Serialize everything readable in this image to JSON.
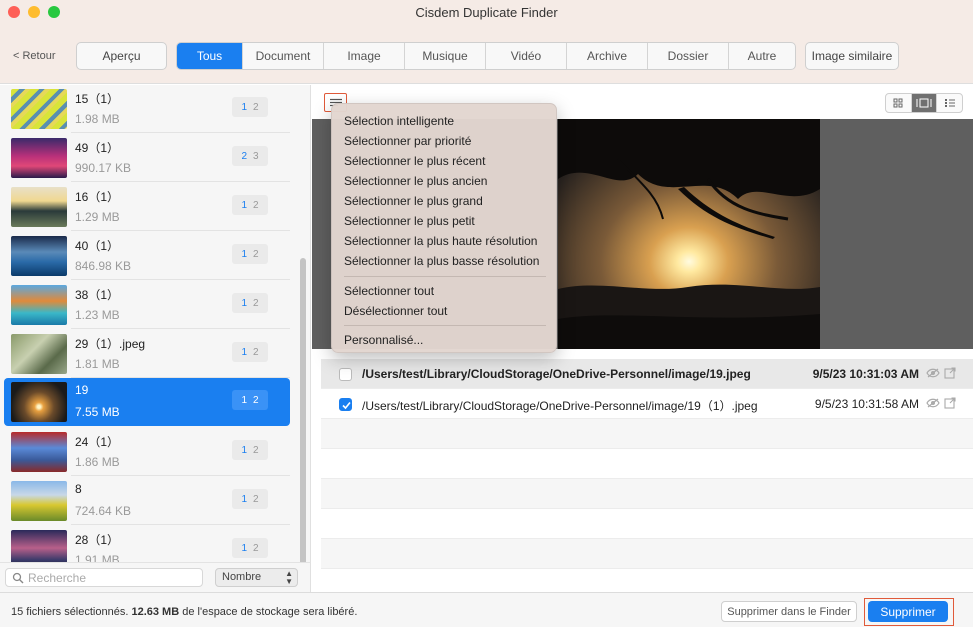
{
  "window": {
    "title": "Cisdem Duplicate Finder"
  },
  "toolbar": {
    "back_label": "< Retour",
    "preview_label": "Aperçu",
    "tabs": [
      {
        "label": "Tous",
        "active": true
      },
      {
        "label": "Document"
      },
      {
        "label": "Image"
      },
      {
        "label": "Musique"
      },
      {
        "label": "Vidéo"
      },
      {
        "label": "Archive"
      },
      {
        "label": "Dossier"
      },
      {
        "label": "Autre"
      }
    ],
    "similar_label": "Image similaire"
  },
  "sidebar": {
    "groups": [
      {
        "name": "15（1）",
        "size": "1.98 MB",
        "b1": "1",
        "b2": "2"
      },
      {
        "name": "49（1）",
        "size": "990.17 KB",
        "b1": "2",
        "b2": "3"
      },
      {
        "name": "16（1）",
        "size": "1.29 MB",
        "b1": "1",
        "b2": "2"
      },
      {
        "name": "40（1）",
        "size": "846.98 KB",
        "b1": "1",
        "b2": "2"
      },
      {
        "name": "38（1）",
        "size": "1.23 MB",
        "b1": "1",
        "b2": "2"
      },
      {
        "name": "29（1）.jpeg",
        "size": "1.81 MB",
        "b1": "1",
        "b2": "2"
      },
      {
        "name": "19",
        "size": "7.55 MB",
        "b1": "1",
        "b2": "2",
        "selected": true
      },
      {
        "name": "24（1）",
        "size": "1.86 MB",
        "b1": "1",
        "b2": "2"
      },
      {
        "name": "8",
        "size": "724.64 KB",
        "b1": "1",
        "b2": "2"
      },
      {
        "name": "28（1）",
        "size": "1.91 MB",
        "b1": "1",
        "b2": "2"
      }
    ],
    "search_placeholder": "Recherche",
    "sort_label": "Nombre"
  },
  "menu": {
    "items": [
      "Sélection intelligente",
      "Sélectionner par priorité",
      "Sélectionner le plus récent",
      "Sélectionner le plus ancien",
      "Sélectionner le plus grand",
      "Sélectionner le plus petit",
      "Sélectionner la plus haute résolution",
      "Sélectionner la plus basse résolution",
      "Sélectionner tout",
      "Désélectionner tout",
      "Personnalisé..."
    ]
  },
  "files": [
    {
      "path": "/Users/test/Library/CloudStorage/OneDrive-Personnel/image/19.jpeg",
      "date": "9/5/23 10:31:03 AM",
      "checked": false
    },
    {
      "path": "/Users/test/Library/CloudStorage/OneDrive-Personnel/image/19（1）.jpeg",
      "date": "9/5/23 10:31:58 AM",
      "checked": true
    }
  ],
  "status": {
    "prefix": "15 fichiers sélectionnés.",
    "amount": "12.63 MB",
    "suffix": "de l'espace de stockage sera libéré.",
    "finder_button": "Supprimer dans le Finder",
    "delete_button": "Supprimer"
  },
  "colors": {
    "accent": "#1a7ff0",
    "highlight_outline": "#e05a3a"
  }
}
